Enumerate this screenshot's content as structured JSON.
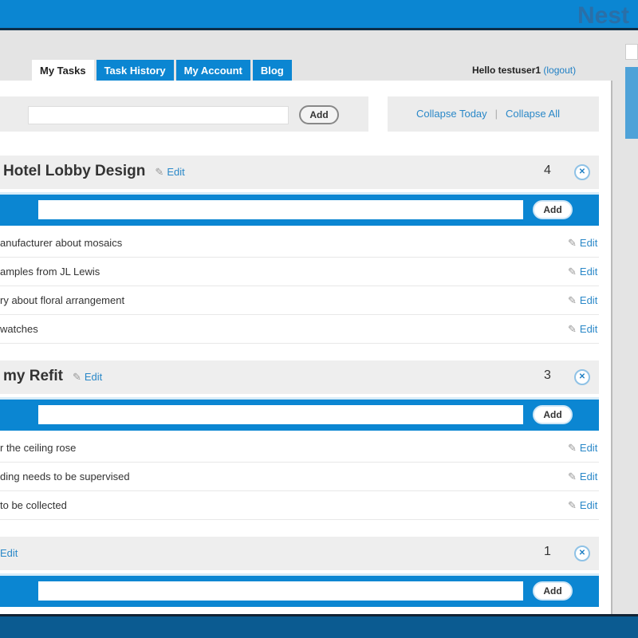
{
  "brand": "Nest",
  "tabs": [
    "My Tasks",
    "Task History",
    "My Account",
    "Blog"
  ],
  "user": {
    "greeting": "Hello testuser1",
    "logout": "(logout)"
  },
  "quick_add": {
    "button": "Add"
  },
  "collapse": {
    "today": "Collapse Today",
    "sep": "|",
    "all": "Collapse All"
  },
  "edit_label": "Edit",
  "sections": [
    {
      "title": "Hotel Lobby Design",
      "count": "4",
      "add": "Add",
      "tasks": [
        "anufacturer about mosaics",
        "amples from JL Lewis",
        "ry about floral arrangement",
        "watches"
      ]
    },
    {
      "title": "my Refit",
      "count": "3",
      "add": "Add",
      "tasks": [
        "r the ceiling rose",
        "ding needs to be supervised",
        "to be collected"
      ]
    },
    {
      "title": "",
      "count": "1",
      "add": "Add",
      "tasks": []
    }
  ],
  "colors": {
    "primary": "#0b86d2",
    "footer": "#0b5b91"
  }
}
